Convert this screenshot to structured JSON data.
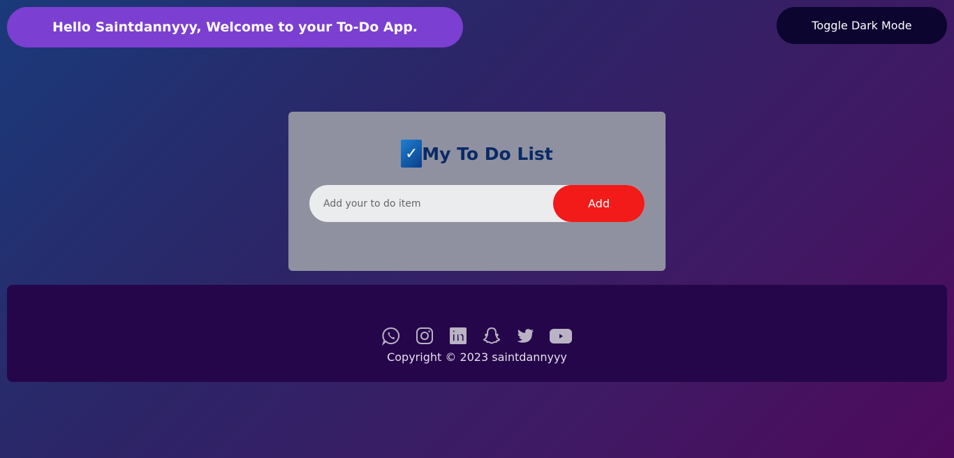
{
  "header": {
    "greeting": "Hello Saintdannyyy, Welcome to your To-Do App.",
    "toggle_label": "Toggle Dark Mode"
  },
  "card": {
    "check_glyph": "✓",
    "title": "My To Do List",
    "input_placeholder": "Add your to do item",
    "input_value": "",
    "add_label": "Add"
  },
  "footer": {
    "social_icons": [
      "whatsapp-icon",
      "instagram-icon",
      "linkedin-icon",
      "snapchat-icon",
      "twitter-icon",
      "youtube-icon"
    ],
    "copyright": "Copyright © 2023 saintdannyyy"
  },
  "colors": {
    "greeting_bg": "#7b3fd1",
    "toggle_bg": "#0c0530",
    "card_bg": "#9091a0",
    "title_color": "#0a2a66",
    "add_button_bg": "#f31a1a",
    "footer_bg": "#25064a"
  }
}
